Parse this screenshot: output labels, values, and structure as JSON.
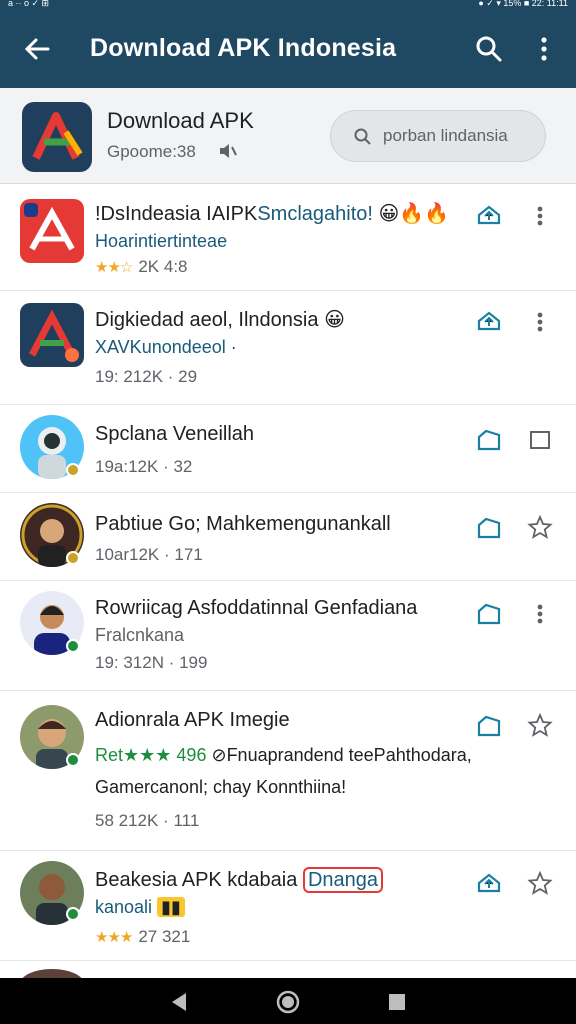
{
  "status_bar": {
    "left": "a ·· o ✓ ⊞",
    "right": "●  ✓ ▾ 15% ■  22:  11:11"
  },
  "app_bar": {
    "title": "Download APK Indonesia"
  },
  "header": {
    "app_name": "Download APK",
    "app_sub": "Gpoome:38",
    "search_placeholder": "porban lindansia"
  },
  "items": [
    {
      "title": "!DsIndeasia IAIPK",
      "title_accent": "Smclagahito!",
      "emoji": "😀🔥🔥",
      "desc": "Hoarintiertinteae",
      "rating_stars": "★★☆",
      "meta": "2K 4:8",
      "action1": "share-icon",
      "action2": "more-vertical-icon"
    },
    {
      "title": "Digkiedad aeol, Ilndonsia",
      "emoji": "😀",
      "desc": "XAVKunondeeol ·",
      "meta": "19: 212K · 29",
      "action1": "share-icon",
      "action2": "more-vertical-icon"
    },
    {
      "title": "Spclana Veneillah",
      "meta": "19a:12K · 32",
      "action1": "bookmark-icon",
      "action2": "checkbox-icon"
    },
    {
      "title": "Pabtiue Go; Mahkemengunankall",
      "meta": "10ar12K · 171",
      "action1": "bookmark-icon",
      "action2": "star-icon"
    },
    {
      "title": "Rowriicag Asfoddatinnal Genfadiana",
      "desc": "Fralcnkana",
      "meta": "19: 312N · 199",
      "action1": "bookmark-icon",
      "action2": "more-vertical-icon"
    },
    {
      "title": "Adionrala APK Imegie",
      "desc_green": "Ret★★★ 496",
      "desc": "⊘Fnuaprandend teePahthodara,",
      "desc2": "Gamercanonl; chay Konnthiina!",
      "meta": "58 212K · 111",
      "action1": "bookmark-icon",
      "action2": "star-icon"
    },
    {
      "title": "Beakesia APK kdabaia",
      "title_accent": "Dnanga",
      "desc": "kanoali",
      "rating_stars": "★★★",
      "meta": "27 321",
      "action1": "share-icon",
      "action2": "star-icon"
    }
  ],
  "colors": {
    "app_bar": "#1f4862",
    "accent": "#1a7fa0",
    "star": "#f2a626"
  }
}
